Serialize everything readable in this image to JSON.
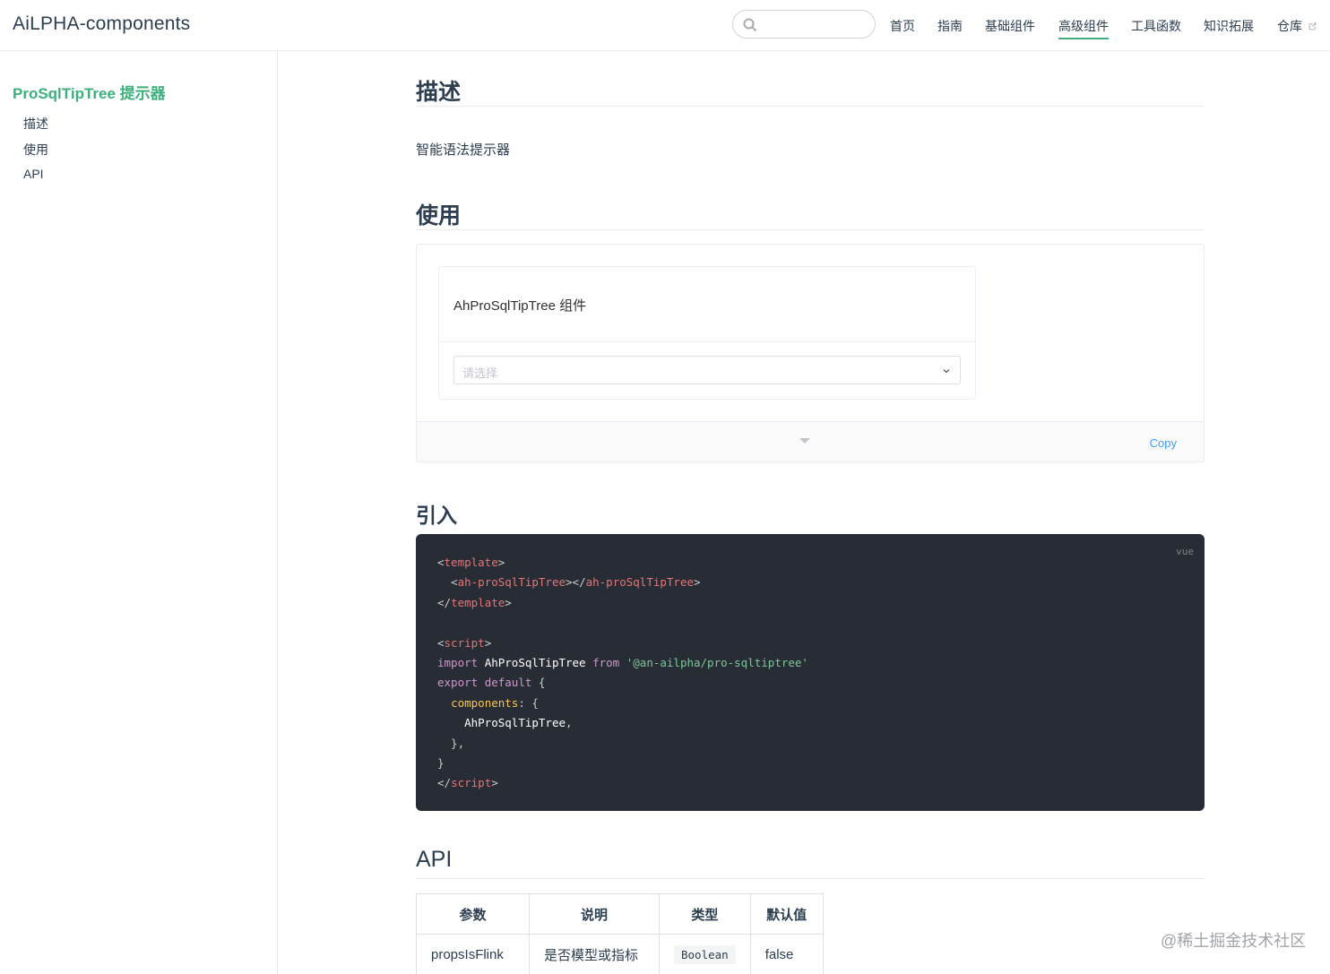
{
  "navbar": {
    "site_name": "AiLPHA-components",
    "search": {
      "value": "",
      "placeholder": ""
    },
    "links": [
      {
        "label": "首页"
      },
      {
        "label": "指南"
      },
      {
        "label": "基础组件"
      },
      {
        "label": "高级组件",
        "active": true
      },
      {
        "label": "工具函数"
      },
      {
        "label": "知识拓展"
      },
      {
        "label": "仓库",
        "external": true
      }
    ]
  },
  "sidebar": {
    "title": "ProSqlTipTree 提示器",
    "items": [
      {
        "label": "描述"
      },
      {
        "label": "使用"
      },
      {
        "label": "API"
      }
    ]
  },
  "content": {
    "section_describe": {
      "heading": "描述",
      "text": "智能语法提示器"
    },
    "section_usage": {
      "heading": "使用",
      "demo": {
        "card_title": "AhProSqlTipTree 组件",
        "select_placeholder": "请选择",
        "copy_label": "Copy"
      }
    },
    "section_import": {
      "heading": "引入",
      "code_lang": "vue"
    },
    "section_api": {
      "heading": "API",
      "table": {
        "headers": [
          "参数",
          "说明",
          "类型",
          "默认值"
        ],
        "rows": [
          {
            "param": "propsIsFlink",
            "desc": "是否模型或指标",
            "type": "Boolean",
            "default": "false"
          }
        ]
      }
    }
  },
  "watermark": "@稀土掘金技术社区",
  "colors": {
    "accent": "#3eaf7c",
    "link": "#409eff",
    "code_bg": "#282c34"
  }
}
